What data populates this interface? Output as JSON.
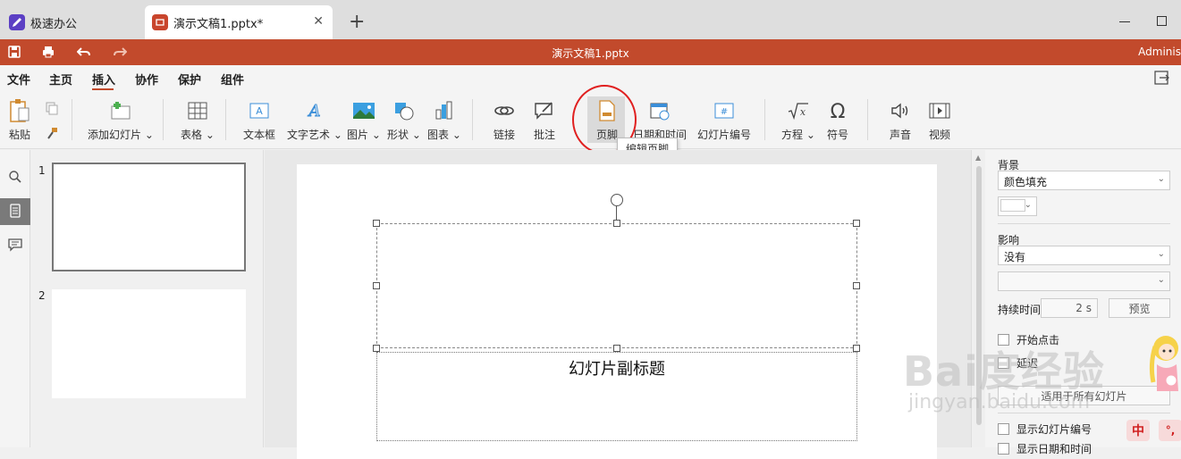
{
  "tabs": [
    {
      "label": "极速办公"
    },
    {
      "label": "演示文稿1.pptx*"
    }
  ],
  "titlebar": {
    "doc_title": "演示文稿1.pptx",
    "user": "Adminis"
  },
  "menu": {
    "items": [
      "文件",
      "主页",
      "插入",
      "协作",
      "保护",
      "组件"
    ],
    "active": "插入"
  },
  "ribbon": {
    "paste": "粘贴",
    "add_slide": "添加幻灯片",
    "table": "表格",
    "textbox": "文本框",
    "wordart": "文字艺术",
    "image": "图片",
    "shape": "形状",
    "chart": "图表",
    "link": "链接",
    "comment": "批注",
    "footer": "页脚",
    "datetime": "日期和时间",
    "slide_number": "幻灯片编号",
    "equation": "方程",
    "symbol": "符号",
    "audio": "声音",
    "video": "视频"
  },
  "tooltip": "编辑页脚",
  "thumbnails": [
    {
      "num": "1"
    },
    {
      "num": "2"
    }
  ],
  "slide": {
    "subtitle": "幻灯片副标题"
  },
  "right_panel": {
    "background_label": "背景",
    "background_value": "颜色填充",
    "effect_label": "影响",
    "effect_value": "没有",
    "duration_label": "持续时间",
    "duration_value": "2 s",
    "preview_button": "预览",
    "start_on_click": "开始点击",
    "delay_label": "延迟",
    "apply_all_button": "适用于所有幻灯片",
    "show_slide_number": "显示幻灯片编号",
    "show_datetime": "显示日期和时间"
  },
  "watermark": {
    "logo": "Bai度经验",
    "url": "jingyan.baidu.com"
  },
  "ime": {
    "mode": "中",
    "punct": "°,"
  },
  "colors": {
    "accent": "#c24a2c",
    "highlight_circle": "#e02020"
  }
}
